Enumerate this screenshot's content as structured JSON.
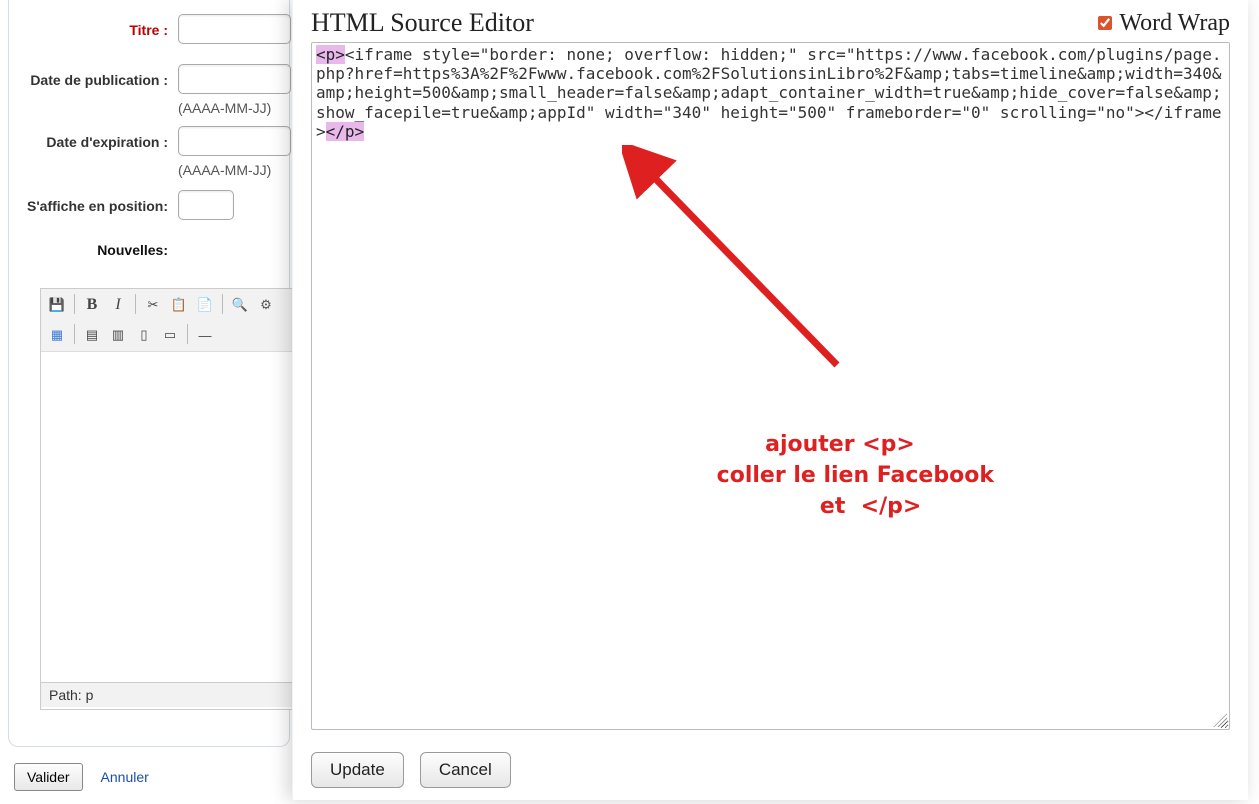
{
  "form": {
    "titre_label": "Titre :",
    "date_pub_label": "Date de publication :",
    "date_exp_label": "Date d'expiration :",
    "position_label": "S'affiche en position:",
    "nouvelles_label": "Nouvelles:",
    "hint_format": "(AAAA-MM-JJ)",
    "titre_value": "",
    "date_pub_value": "",
    "date_exp_value": "",
    "position_value": ""
  },
  "toolbar_icons": {
    "save": "💾",
    "bold": "B",
    "italic": "I",
    "cut": "✂",
    "copy": "📋",
    "paste": "📄",
    "find": "🔍",
    "replace": "⚙",
    "table": "▦",
    "row1": "▤",
    "row2": "▥",
    "col1": "▯",
    "col2": "▭",
    "anchor": "—"
  },
  "editor": {
    "path_label": "Path: ",
    "path_value": "p"
  },
  "buttons": {
    "valider": "Valider",
    "annuler": "Annuler"
  },
  "modal": {
    "title": "HTML Source Editor",
    "wordwrap_label": "Word Wrap",
    "wordwrap_checked": true,
    "update": "Update",
    "cancel": "Cancel",
    "source_open": "<p>",
    "source_mid": "<iframe style=\"border: none; overflow: hidden;\" src=\"https://www.facebook.com/plugins/page.php?href=https%3A%2F%2Fwww.facebook.com%2FSolutionsinLibro%2F&amp;tabs=timeline&amp;width=340&amp;height=500&amp;small_header=false&amp;adapt_container_width=true&amp;hide_cover=false&amp;show_facepile=true&amp;appId\" width=\"340\" height=\"500\" frameborder=\"0\" scrolling=\"no\"></iframe>",
    "source_close": "</p>"
  },
  "annotation": {
    "text": "ajouter <p>\n    coller le lien Facebook\n        et  </p>"
  }
}
